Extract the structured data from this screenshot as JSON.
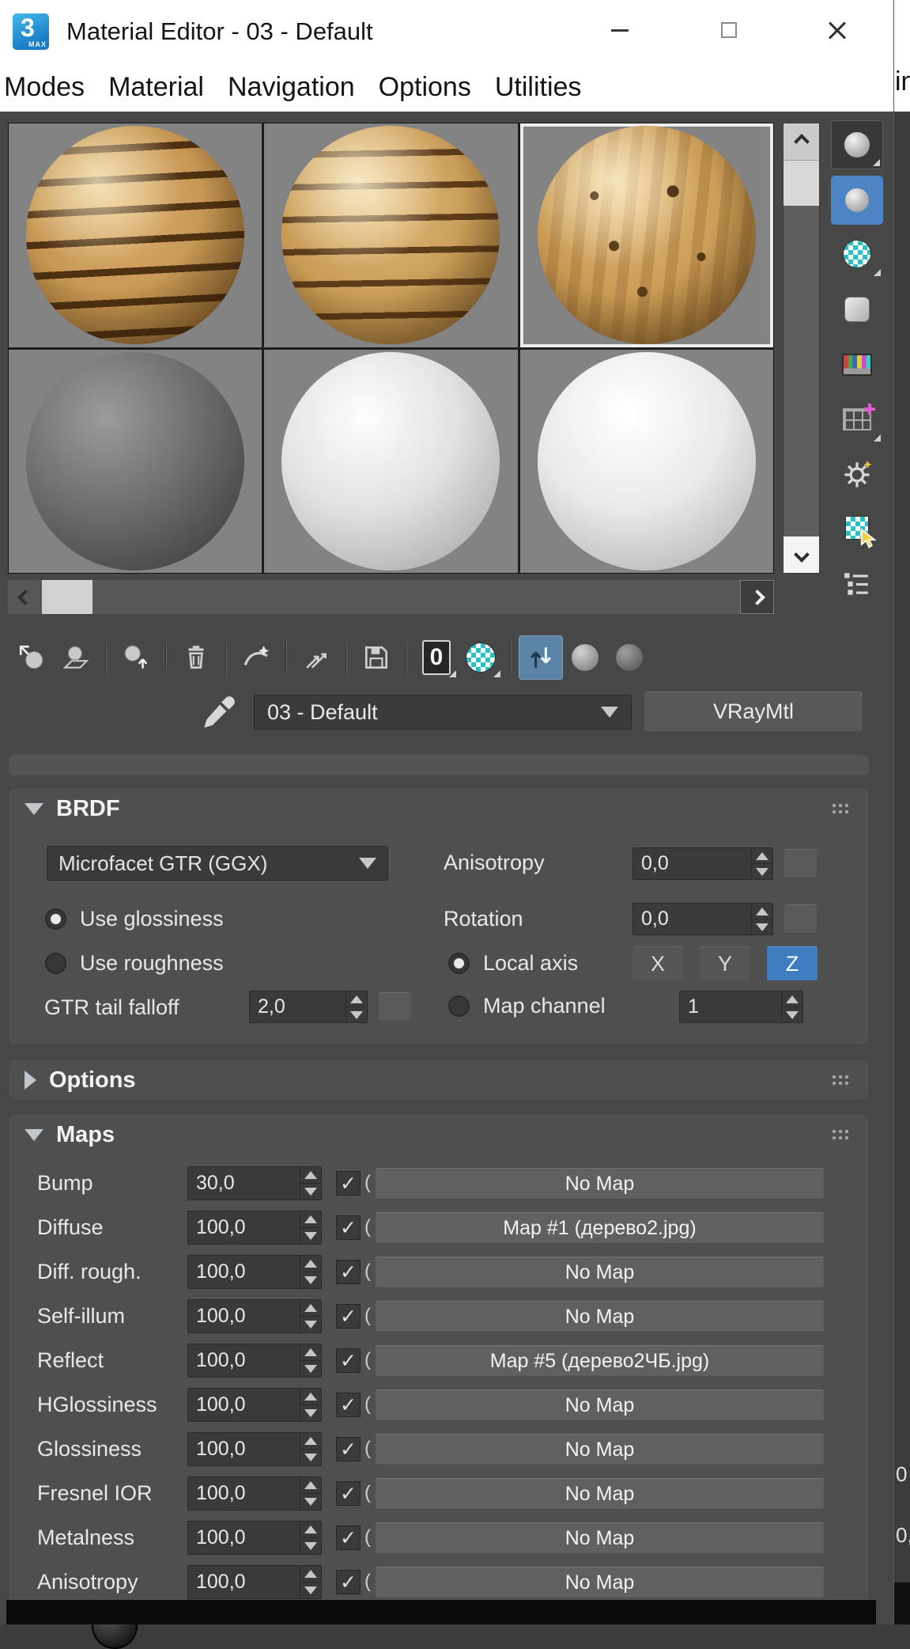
{
  "window": {
    "logo": "3",
    "logo_sub": "MAX",
    "title": "Material Editor - 03 - Default"
  },
  "menu": {
    "items": [
      "Modes",
      "Material",
      "Navigation",
      "Options",
      "Utilities"
    ]
  },
  "sample_slots": {
    "selected_index": 2,
    "descriptions": [
      "wood sphere with dark rings",
      "wood sphere with dark rings",
      "wood sphere with knots (selected)",
      "dark gray sphere",
      "light gray sphere",
      "light gray sphere"
    ]
  },
  "toolbar": {
    "material_id": "0"
  },
  "material": {
    "name": "03 - Default",
    "type": "VRayMtl"
  },
  "rollouts": {
    "brdf": {
      "title": "BRDF",
      "type_dropdown": "Microfacet GTR (GGX)",
      "use_glossiness": "Use glossiness",
      "use_roughness": "Use roughness",
      "gtr_tail_falloff_label": "GTR tail falloff",
      "gtr_tail_falloff_value": "2,0",
      "anisotropy_label": "Anisotropy",
      "anisotropy_value": "0,0",
      "rotation_label": "Rotation",
      "rotation_value": "0,0",
      "local_axis_label": "Local axis",
      "axes": [
        "X",
        "Y",
        "Z"
      ],
      "active_axis": "Z",
      "map_channel_label": "Map channel",
      "map_channel_value": "1"
    },
    "options": {
      "title": "Options"
    },
    "maps": {
      "title": "Maps",
      "check_glyph": "✓",
      "partial_glyph": "(",
      "rows": [
        {
          "label": "Bump",
          "amount": "30,0",
          "checked": true,
          "map": "No Map"
        },
        {
          "label": "Diffuse",
          "amount": "100,0",
          "checked": true,
          "map": "Map #1 (дерево2.jpg)"
        },
        {
          "label": "Diff. rough.",
          "amount": "100,0",
          "checked": true,
          "map": "No Map"
        },
        {
          "label": "Self-illum",
          "amount": "100,0",
          "checked": true,
          "map": "No Map"
        },
        {
          "label": "Reflect",
          "amount": "100,0",
          "checked": true,
          "map": "Map #5 (дерево2ЧБ.jpg)"
        },
        {
          "label": "HGlossiness",
          "amount": "100,0",
          "checked": true,
          "map": "No Map"
        },
        {
          "label": "Glossiness",
          "amount": "100,0",
          "checked": true,
          "map": "No Map"
        },
        {
          "label": "Fresnel IOR",
          "amount": "100,0",
          "checked": true,
          "map": "No Map"
        },
        {
          "label": "Metalness",
          "amount": "100,0",
          "checked": true,
          "map": "No Map"
        },
        {
          "label": "Anisotropy",
          "amount": "100,0",
          "checked": true,
          "map": "No Map"
        }
      ]
    }
  },
  "background_app": {
    "partial_top_text": "in",
    "partial_values": [
      "0",
      "0,"
    ]
  },
  "colors": {
    "selection_blue": "#4d84c4",
    "active_axis_blue": "#3f7dc0",
    "toolbar_active": "#5b83a6",
    "checker_teal": "#2bc0c4"
  }
}
